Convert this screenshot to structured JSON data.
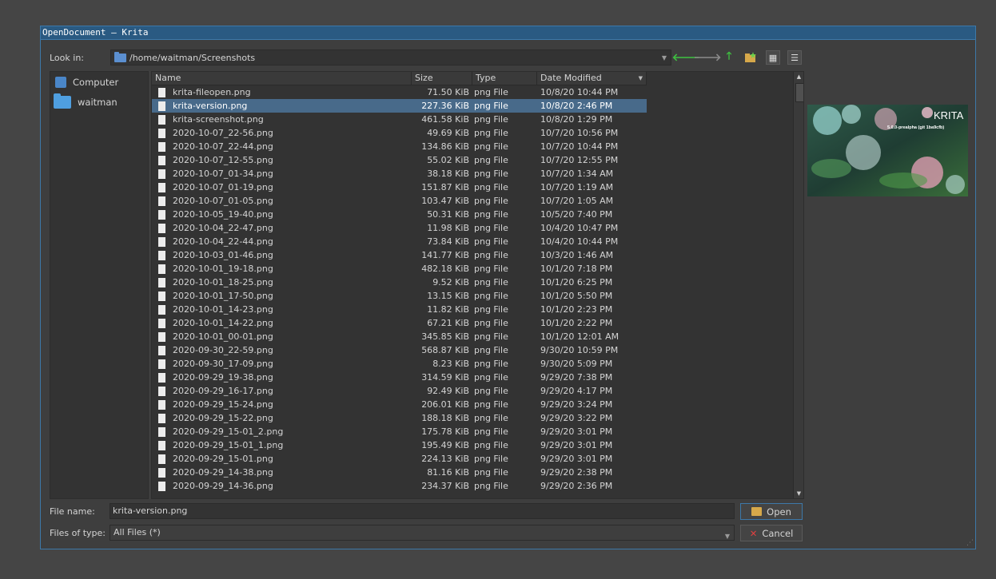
{
  "window": {
    "title": "OpenDocument — Krita"
  },
  "toolbar": {
    "look_in_label": "Look in:",
    "path": "/home/waitman/Screenshots",
    "buttons": [
      "back-icon",
      "forward-icon",
      "up-icon",
      "new-folder-icon",
      "icon-view-icon",
      "detail-view-icon"
    ]
  },
  "sidebar": {
    "items": [
      {
        "label": "Computer",
        "icon": "computer-icon"
      },
      {
        "label": "waitman",
        "icon": "folder-icon"
      }
    ]
  },
  "columns": {
    "name": "Name",
    "size": "Size",
    "type": "Type",
    "date": "Date Modified"
  },
  "files": [
    {
      "name": "krita-fileopen.png",
      "size": "71.50 KiB",
      "type": "png File",
      "date": "10/8/20 10:44 PM"
    },
    {
      "name": "krita-version.png",
      "size": "227.36 KiB",
      "type": "png File",
      "date": "10/8/20 2:46 PM",
      "selected": true
    },
    {
      "name": "krita-screenshot.png",
      "size": "461.58 KiB",
      "type": "png File",
      "date": "10/8/20 1:29 PM"
    },
    {
      "name": "2020-10-07_22-56.png",
      "size": "49.69 KiB",
      "type": "png File",
      "date": "10/7/20 10:56 PM"
    },
    {
      "name": "2020-10-07_22-44.png",
      "size": "134.86 KiB",
      "type": "png File",
      "date": "10/7/20 10:44 PM"
    },
    {
      "name": "2020-10-07_12-55.png",
      "size": "55.02 KiB",
      "type": "png File",
      "date": "10/7/20 12:55 PM"
    },
    {
      "name": "2020-10-07_01-34.png",
      "size": "38.18 KiB",
      "type": "png File",
      "date": "10/7/20 1:34 AM"
    },
    {
      "name": "2020-10-07_01-19.png",
      "size": "151.87 KiB",
      "type": "png File",
      "date": "10/7/20 1:19 AM"
    },
    {
      "name": "2020-10-07_01-05.png",
      "size": "103.47 KiB",
      "type": "png File",
      "date": "10/7/20 1:05 AM"
    },
    {
      "name": "2020-10-05_19-40.png",
      "size": "50.31 KiB",
      "type": "png File",
      "date": "10/5/20 7:40 PM"
    },
    {
      "name": "2020-10-04_22-47.png",
      "size": "11.98 KiB",
      "type": "png File",
      "date": "10/4/20 10:47 PM"
    },
    {
      "name": "2020-10-04_22-44.png",
      "size": "73.84 KiB",
      "type": "png File",
      "date": "10/4/20 10:44 PM"
    },
    {
      "name": "2020-10-03_01-46.png",
      "size": "141.77 KiB",
      "type": "png File",
      "date": "10/3/20 1:46 AM"
    },
    {
      "name": "2020-10-01_19-18.png",
      "size": "482.18 KiB",
      "type": "png File",
      "date": "10/1/20 7:18 PM"
    },
    {
      "name": "2020-10-01_18-25.png",
      "size": "9.52 KiB",
      "type": "png File",
      "date": "10/1/20 6:25 PM"
    },
    {
      "name": "2020-10-01_17-50.png",
      "size": "13.15 KiB",
      "type": "png File",
      "date": "10/1/20 5:50 PM"
    },
    {
      "name": "2020-10-01_14-23.png",
      "size": "11.82 KiB",
      "type": "png File",
      "date": "10/1/20 2:23 PM"
    },
    {
      "name": "2020-10-01_14-22.png",
      "size": "67.21 KiB",
      "type": "png File",
      "date": "10/1/20 2:22 PM"
    },
    {
      "name": "2020-10-01_00-01.png",
      "size": "345.85 KiB",
      "type": "png File",
      "date": "10/1/20 12:01 AM"
    },
    {
      "name": "2020-09-30_22-59.png",
      "size": "568.87 KiB",
      "type": "png File",
      "date": "9/30/20 10:59 PM"
    },
    {
      "name": "2020-09-30_17-09.png",
      "size": "8.23 KiB",
      "type": "png File",
      "date": "9/30/20 5:09 PM"
    },
    {
      "name": "2020-09-29_19-38.png",
      "size": "314.59 KiB",
      "type": "png File",
      "date": "9/29/20 7:38 PM"
    },
    {
      "name": "2020-09-29_16-17.png",
      "size": "92.49 KiB",
      "type": "png File",
      "date": "9/29/20 4:17 PM"
    },
    {
      "name": "2020-09-29_15-24.png",
      "size": "206.01 KiB",
      "type": "png File",
      "date": "9/29/20 3:24 PM"
    },
    {
      "name": "2020-09-29_15-22.png",
      "size": "188.18 KiB",
      "type": "png File",
      "date": "9/29/20 3:22 PM"
    },
    {
      "name": "2020-09-29_15-01_2.png",
      "size": "175.78 KiB",
      "type": "png File",
      "date": "9/29/20 3:01 PM"
    },
    {
      "name": "2020-09-29_15-01_1.png",
      "size": "195.49 KiB",
      "type": "png File",
      "date": "9/29/20 3:01 PM"
    },
    {
      "name": "2020-09-29_15-01.png",
      "size": "224.13 KiB",
      "type": "png File",
      "date": "9/29/20 3:01 PM"
    },
    {
      "name": "2020-09-29_14-38.png",
      "size": "81.16 KiB",
      "type": "png File",
      "date": "9/29/20 2:38 PM"
    },
    {
      "name": "2020-09-29_14-36.png",
      "size": "234.37 KiB",
      "type": "png File",
      "date": "9/29/20 2:36 PM"
    }
  ],
  "preview": {
    "brand": "KRITA",
    "version_text": "5.0.0-prealpha (git 1ba9cfb)"
  },
  "form": {
    "file_name_label": "File name:",
    "file_name_value": "krita-version.png",
    "file_type_label": "Files of type:",
    "file_type_value": "All Files (*)",
    "open_label": "Open",
    "cancel_label": "Cancel"
  },
  "colors": {
    "selection": "#486a8a",
    "accent": "#3d78a8",
    "nav_green": "#3ec040"
  }
}
